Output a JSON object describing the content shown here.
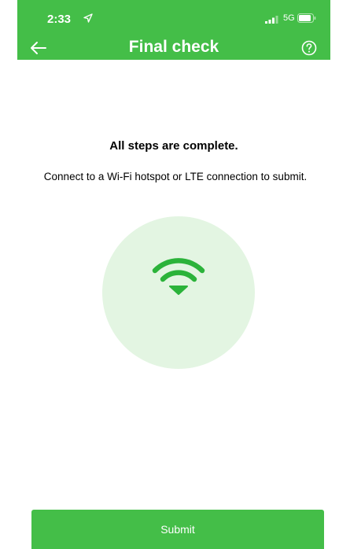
{
  "status_bar": {
    "time": "2:33",
    "network": "5G"
  },
  "header": {
    "title": "Final check"
  },
  "main": {
    "headline": "All steps are complete.",
    "message": "Connect to a Wi-Fi hotspot or LTE connection to submit."
  },
  "submit": {
    "label": "Submit"
  },
  "icons": {
    "back": "arrow-left-icon",
    "help": "question-circle-icon",
    "wifi": "wifi-icon",
    "location": "location-arrow-icon",
    "signal": "signal-bars-icon",
    "battery": "battery-icon"
  },
  "colors": {
    "brand_green": "#44be48",
    "wifi_circle": "#e3f5e2",
    "wifi_icon": "#2bb33a"
  }
}
